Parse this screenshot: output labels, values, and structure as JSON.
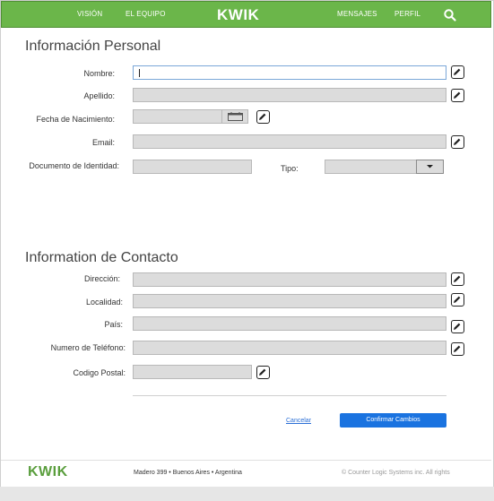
{
  "nav": {
    "links": {
      "vision": "VISIÓN",
      "team": "EL EQUIPO",
      "messages": "MENSAJES",
      "profile": "PERFIL"
    },
    "brand": "KWIK",
    "search_icon": "search-icon"
  },
  "personal": {
    "title": "Información Personal",
    "first_name_label": "Nombre:",
    "first_name_value": "",
    "last_name_label": "Apellido:",
    "birth_date_label": "Fecha de Nacimiento:",
    "email_label": "Email:",
    "id_doc_label": "Documento de Identidad:",
    "type_label": "Tipo:"
  },
  "contact": {
    "title": "Information de Contacto",
    "address_label": "Dirección:",
    "city_label": "Localidad:",
    "country_label": "País:",
    "phone_label": "Numero de Teléfono:",
    "postal_label": "Codigo Postal:"
  },
  "actions": {
    "cancel": "Cancelar",
    "confirm": "Confirmar Cambios"
  },
  "footer": {
    "brand": "KWIK",
    "address": "Madero 399 • Buenos Aires • Argentina",
    "copyright": "© Counter Logic Systems inc. All rights"
  },
  "colors": {
    "nav_green": "#6bb64a",
    "primary_blue": "#1a73e0",
    "footer_green": "#5a9e3d"
  }
}
